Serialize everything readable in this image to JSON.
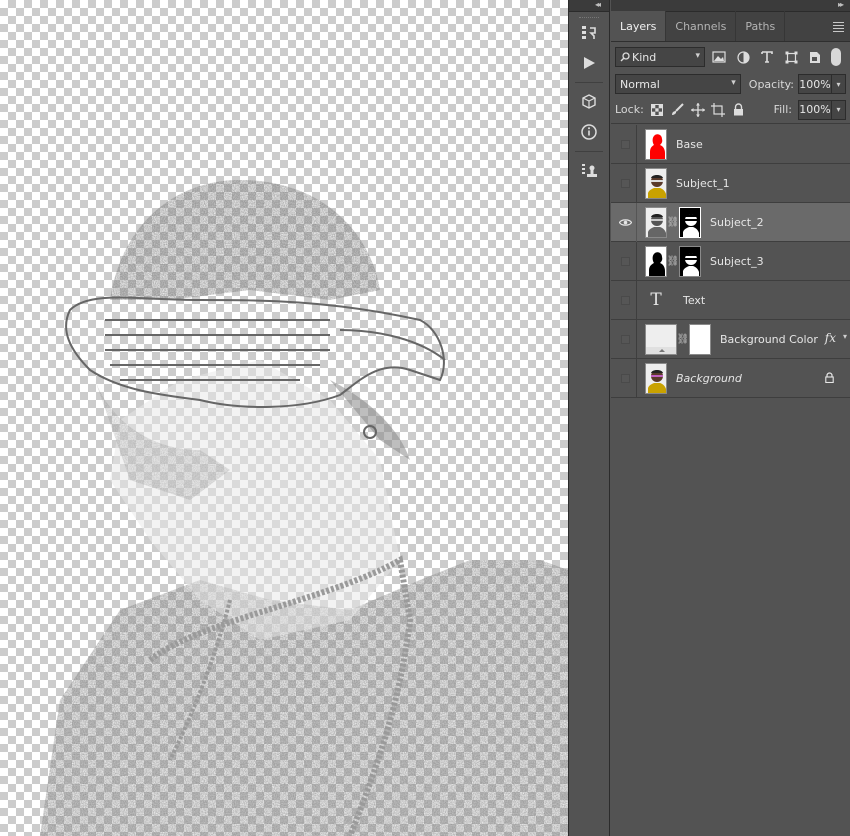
{
  "panel": {
    "tabs": [
      {
        "label": "Layers",
        "active": true
      },
      {
        "label": "Channels",
        "active": false
      },
      {
        "label": "Paths",
        "active": false
      }
    ],
    "filter": {
      "kind_label": "Kind"
    },
    "blend_mode": "Normal",
    "opacity_label": "Opacity:",
    "opacity_value": "100%",
    "lock_label": "Lock:",
    "fill_label": "Fill:",
    "fill_value": "100%",
    "layers": [
      {
        "name": "Base",
        "visible": false,
        "selected": false,
        "thumb": "red-silhouette"
      },
      {
        "name": "Subject_1",
        "visible": false,
        "selected": false,
        "thumb": "photo"
      },
      {
        "name": "Subject_2",
        "visible": true,
        "selected": true,
        "thumb": "photo",
        "mask": "bw-portrait"
      },
      {
        "name": "Subject_3",
        "visible": false,
        "selected": false,
        "thumb": "black-silhouette",
        "mask": "bw-portrait"
      },
      {
        "name": "Text",
        "visible": false,
        "selected": false,
        "thumb": "type-icon"
      },
      {
        "name": "Background Color",
        "visible": false,
        "selected": false,
        "thumb": "fill",
        "mask": "white",
        "effects": "fx"
      },
      {
        "name": "Background",
        "visible": false,
        "selected": false,
        "thumb": "photo",
        "locked": true
      }
    ]
  },
  "colors": {
    "panel_bg": "#535353",
    "selected_layer": "#6a6a6a",
    "base_thumb": "#ff0000"
  }
}
